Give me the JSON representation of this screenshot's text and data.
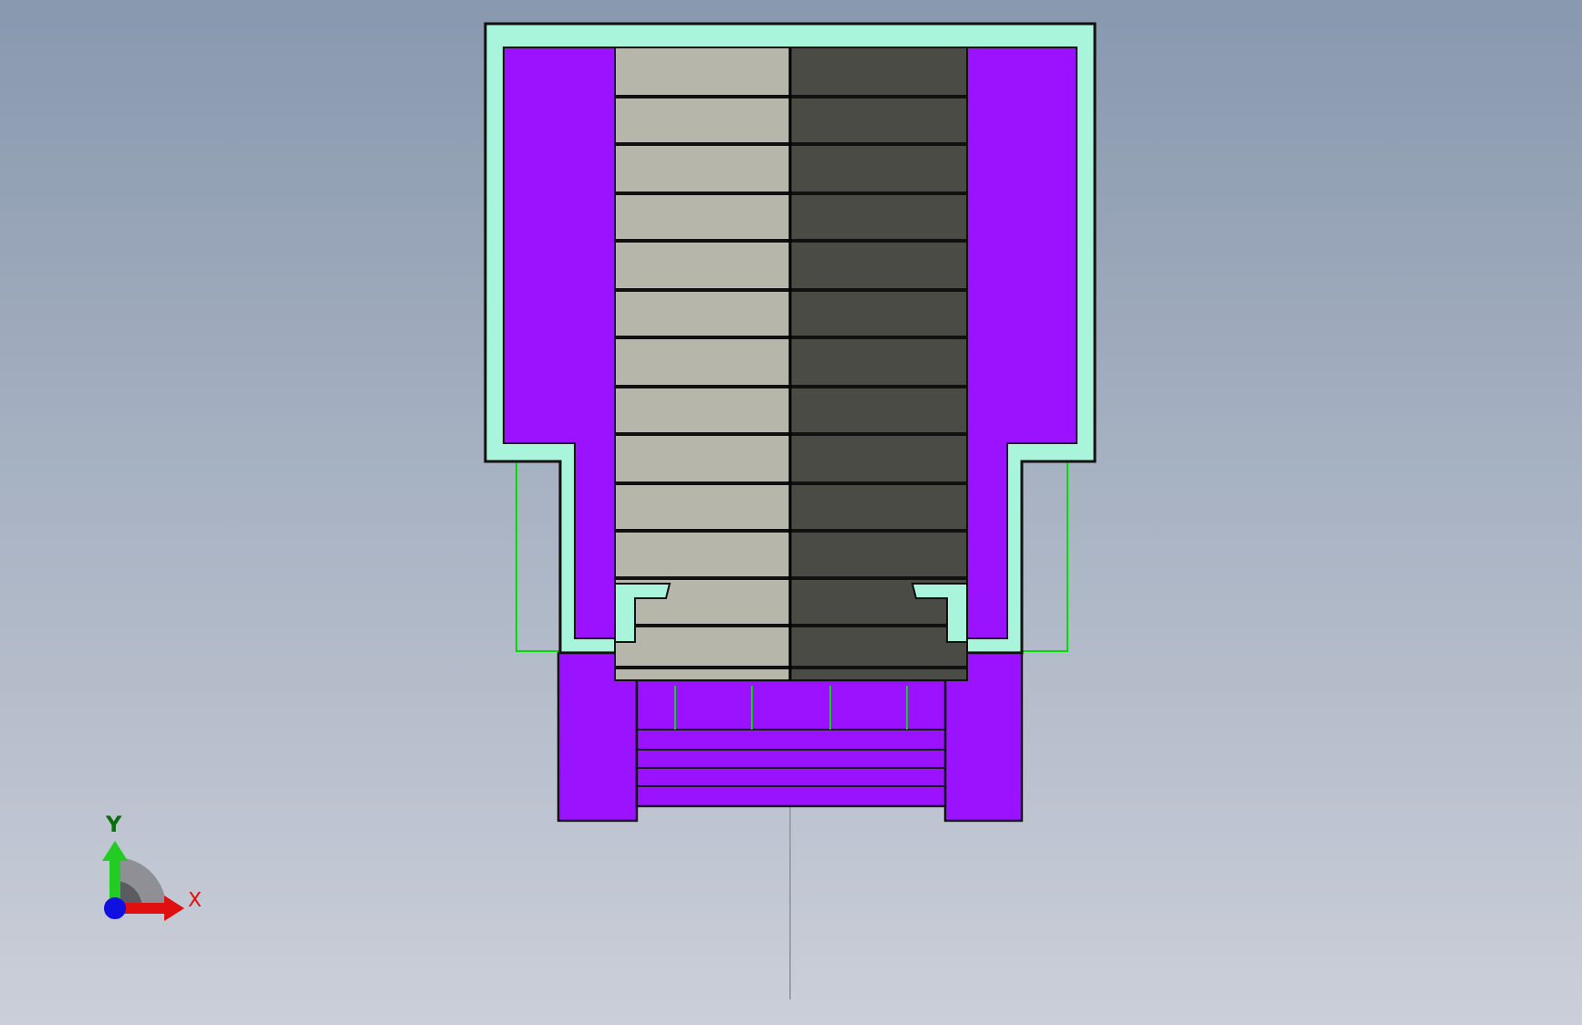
{
  "viewport": {
    "triad": {
      "y_label": "Y",
      "x_label": "X"
    }
  }
}
